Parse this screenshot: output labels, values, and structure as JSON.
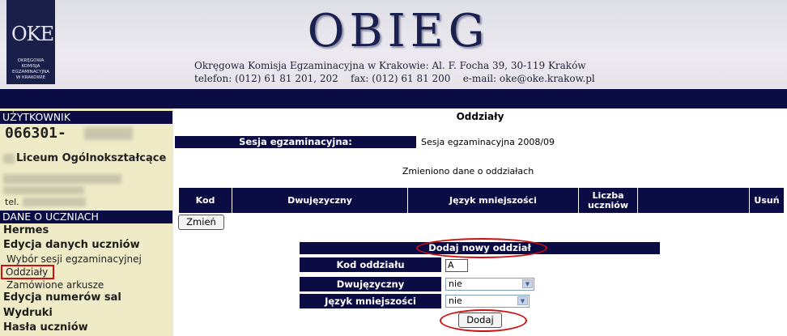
{
  "header": {
    "logo_text": "OKE",
    "logo_sub_lines": [
      "OKRĘGOWA",
      "KOMISJA",
      "EGZAMINACYJNA",
      "W KRAKOWIE"
    ],
    "title": "OBIEG",
    "address": "Okręgowa Komisja Egzaminacyjna w Krakowie: Al. F. Focha 39, 30-119 Kraków",
    "contact": "telefon: (012) 61 81 201, 202    fax: (012) 61 81 200    e-mail: oke@oke.krakow.pl"
  },
  "sidebar": {
    "user_header": "UŻYTKOWNIK",
    "user_code": "066301-",
    "school_name": "Liceum Ogólnokształcące",
    "tel_label": "tel.",
    "section_header": "DANE O UCZNIACH",
    "items": [
      {
        "label": "Hermes",
        "type": "main"
      },
      {
        "label": "Edycja danych uczniów",
        "type": "main"
      },
      {
        "label": "Wybór sesji egzaminacyjnej",
        "type": "sub"
      },
      {
        "label": "Oddziały",
        "type": "sub"
      },
      {
        "label": "Zamówione arkusze",
        "type": "sub"
      },
      {
        "label": "Edycja numerów sal",
        "type": "main"
      },
      {
        "label": "Wydruki",
        "type": "main"
      },
      {
        "label": "Hasła uczniów",
        "type": "main"
      }
    ]
  },
  "main": {
    "title": "Oddziały",
    "session_label": "Sesja egzaminacyjna:",
    "session_value": "Sesja egzaminacyjna 2008/09",
    "message": "Zmieniono dane o oddziałach",
    "table_headers": [
      "Kod",
      "Dwujęzyczny",
      "Język mniejszości",
      "Liczba uczniów",
      "",
      "Usuń"
    ],
    "change_button": "Zmień",
    "add_form": {
      "header": "Dodaj nowy oddział",
      "code_label": "Kod oddziału",
      "code_value": "A",
      "bilingual_label": "Dwujęzyczny",
      "bilingual_value": "nie",
      "minority_label": "Język mniejszości",
      "minority_value": "nie",
      "add_button": "Dodaj"
    }
  },
  "colors": {
    "navy": "#0c0c45",
    "sidebar_bg": "#eeebc6",
    "highlight_red": "#d01010"
  }
}
